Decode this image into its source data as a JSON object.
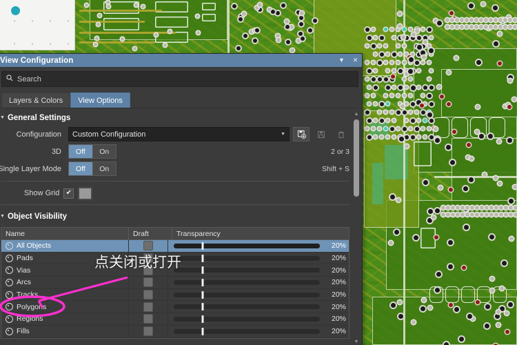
{
  "window": {
    "title": "View Configuration",
    "collapse_icon": "chevron-down-icon",
    "close_icon": "close-icon"
  },
  "search": {
    "icon": "search-icon",
    "placeholder": "Search",
    "value": ""
  },
  "tabs": [
    {
      "label": "Layers & Colors",
      "active": false
    },
    {
      "label": "View Options",
      "active": true
    }
  ],
  "general_settings": {
    "title": "General Settings",
    "configuration": {
      "label": "Configuration",
      "value": "Custom Configuration",
      "buttons": [
        {
          "name": "save-as-new-configuration-button",
          "icon": "save-new-icon",
          "enabled": true
        },
        {
          "name": "save-configuration-button",
          "icon": "floppy-disk-icon",
          "enabled": false
        },
        {
          "name": "delete-configuration-button",
          "icon": "trash-icon",
          "enabled": false
        }
      ]
    },
    "toggles": [
      {
        "label": "3D",
        "off": "Off",
        "on": "On",
        "selected": "Off",
        "hint": "2 or 3"
      },
      {
        "label": "Single Layer Mode",
        "off": "Off",
        "on": "On",
        "selected": "Off",
        "hint": "Shift + S"
      }
    ],
    "show_grid": {
      "label": "Show Grid",
      "checked": true,
      "check_glyph": "✔",
      "color": "#999999"
    }
  },
  "object_visibility": {
    "title": "Object Visibility",
    "columns": [
      "Name",
      "Draft",
      "Transparency"
    ],
    "rows": [
      {
        "name": "All Objects",
        "icon": "visibility-icon",
        "draft": false,
        "transparency": 20,
        "transparency_label": "20%",
        "selected": true
      },
      {
        "name": "Pads",
        "icon": "visibility-icon",
        "draft": false,
        "transparency": 20,
        "transparency_label": "20%",
        "selected": false
      },
      {
        "name": "Vias",
        "icon": "visibility-icon",
        "draft": false,
        "transparency": 20,
        "transparency_label": "20%",
        "selected": false
      },
      {
        "name": "Arcs",
        "icon": "visibility-icon",
        "draft": false,
        "transparency": 20,
        "transparency_label": "20%",
        "selected": false
      },
      {
        "name": "Tracks",
        "icon": "visibility-icon",
        "draft": false,
        "transparency": 20,
        "transparency_label": "20%",
        "selected": false
      },
      {
        "name": "Polygons",
        "icon": "visibility-icon",
        "draft": false,
        "transparency": 20,
        "transparency_label": "20%",
        "selected": false
      },
      {
        "name": "Regions",
        "icon": "visibility-icon",
        "draft": false,
        "transparency": 20,
        "transparency_label": "20%",
        "selected": false
      },
      {
        "name": "Fills",
        "icon": "visibility-icon",
        "draft": false,
        "transparency": 20,
        "transparency_label": "20%",
        "selected": false
      }
    ]
  },
  "annotation": {
    "text": "点关闭或打开",
    "color": "#ff2fd0",
    "circled_row": "Polygons"
  },
  "colors": {
    "accent": "#5d82a6",
    "panel": "#3b3b3b",
    "field": "#232323",
    "pcb_green": "#4a8c19",
    "annotation_magenta": "#ff2fd0",
    "canvas_white": "#f4f5f2",
    "canvas_dot_cyan": "#22a6bd"
  }
}
